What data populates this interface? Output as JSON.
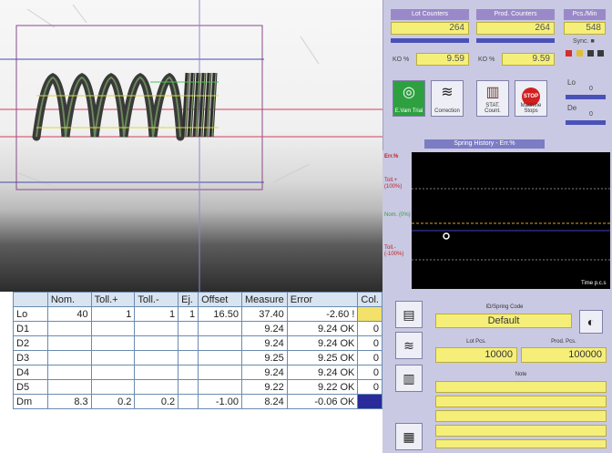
{
  "counters": {
    "lot_label": "Lot Counters",
    "lot_value": "264",
    "prod_label": "Prod. Counters",
    "prod_value": "264",
    "pcs_label": "Pcs./Min",
    "pcs_value": "548",
    "sync_label": "Sync. ■",
    "ko_label_1": "KO %",
    "ko_value_1": "9.59",
    "ko_label_2": "KO %",
    "ko_value_2": "9.59"
  },
  "buttons": {
    "exam": "E.Vam Trial",
    "correction": "Correction",
    "stat": "STAT. Count.",
    "machine_stop": "Machine Stops",
    "stop_glyph": "STOP"
  },
  "sliders": {
    "lo_label": "Lo",
    "lo_value": "0",
    "de_label": "De",
    "de_value": "0"
  },
  "history": {
    "title": "Spring History - Err.%",
    "err_label": "Err.%",
    "tol_plus": "Toll.+ (100%)",
    "nom": "Nom. (0%)",
    "tol_minus": "Toll.- (-100%)",
    "time_label": "Time p.c.s"
  },
  "table": {
    "headers": [
      "",
      "Nom.",
      "Toll.+",
      "Toll.-",
      "Ej.",
      "Offset",
      "Measure",
      "Error",
      "Col."
    ],
    "rows": [
      [
        "Lo",
        "40",
        "1",
        "1",
        "1",
        "16.50",
        "37.40",
        "-2.60 !",
        ""
      ],
      [
        "D1",
        "",
        "",
        "",
        "",
        "",
        "9.24",
        "9.24 OK",
        "0"
      ],
      [
        "D2",
        "",
        "",
        "",
        "",
        "",
        "9.24",
        "9.24 OK",
        "0"
      ],
      [
        "D3",
        "",
        "",
        "",
        "",
        "",
        "9.25",
        "9.25 OK",
        "0"
      ],
      [
        "D4",
        "",
        "",
        "",
        "",
        "",
        "9.24",
        "9.24 OK",
        "0"
      ],
      [
        "D5",
        "",
        "",
        "",
        "",
        "",
        "9.22",
        "9.22 OK",
        "0"
      ],
      [
        "Dm",
        "8.3",
        "0.2",
        "0.2",
        "",
        "-1.00",
        "8.24",
        "-0.06 OK",
        ""
      ]
    ]
  },
  "form": {
    "code_label": "ID/Spring Code",
    "code_value": "Default",
    "lot_pcs_label": "Lot Pcs.",
    "lot_pcs_value": "10000",
    "prod_pcs_label": "Prod. Pcs.",
    "prod_pcs_value": "100000",
    "note_label": "Note"
  },
  "colors": {
    "panel": "#c9c9e3",
    "field_yellow": "#f5ef7a",
    "lo_col": "#f3e26a",
    "dm_col": "#2a2a9a"
  }
}
